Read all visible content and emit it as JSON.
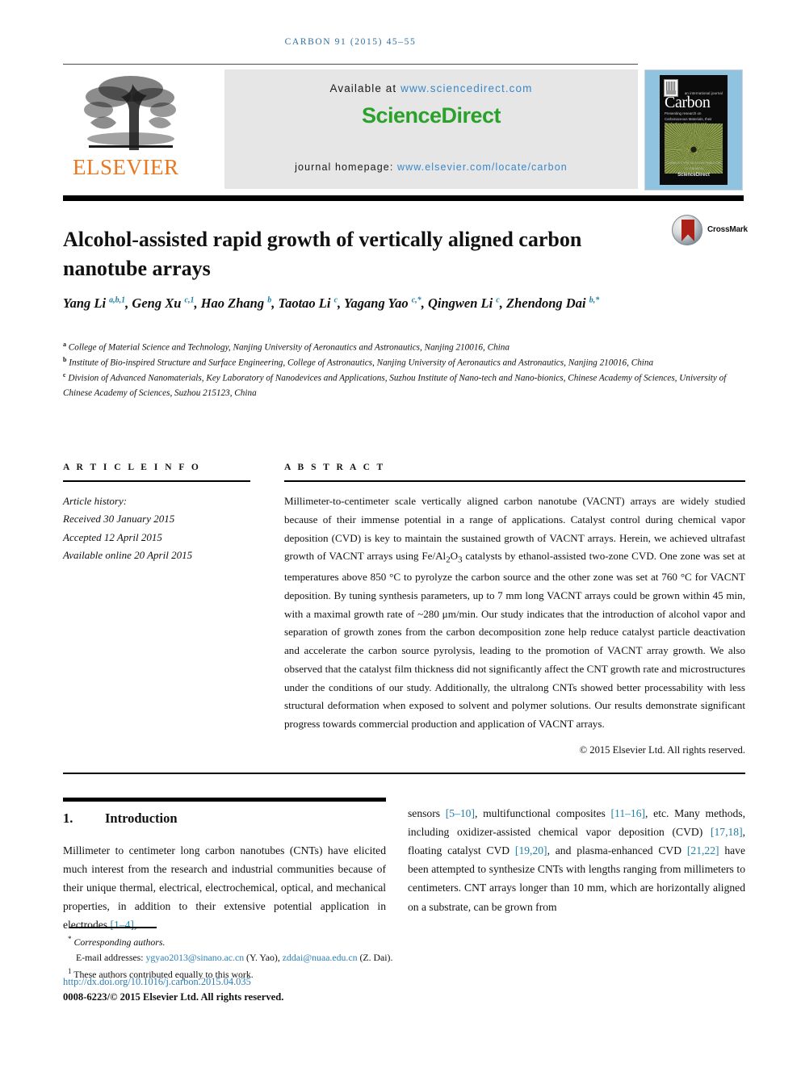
{
  "running_head": "CARBON 91 (2015) 45–55",
  "banner": {
    "publisher_name": "ELSEVIER",
    "available_prefix": "Available at ",
    "available_url": "www.sciencedirect.com",
    "sciencedirect_wordmark": "ScienceDirect",
    "homepage_prefix": "journal homepage: ",
    "homepage_url": "www.elsevier.com/locate/carbon",
    "colors": {
      "elsevier_orange": "#e87722",
      "sciencedirect_green": "#2aa12a",
      "link_blue": "#3a87c8",
      "banner_gray": "#e6e6e6"
    }
  },
  "cover": {
    "title": "Carbon",
    "kicker": "an international journal",
    "subtitle": "Presenting research on Carbonaceous Materials, their Production, Properties and Applications",
    "footer_small": "CARBON TYPE IS A CONTRIBUTOR TO CARBON",
    "footer_brand": "ScienceDirect",
    "border_color": "#8fc3e0"
  },
  "article": {
    "title": "Alcohol-assisted rapid growth of vertically aligned carbon nanotube arrays",
    "crossmark_label": "CrossMark",
    "authors_html": "Yang Li <sup>a,b,1</sup>, Geng Xu <sup>c,1</sup>, Hao Zhang <sup>b</sup>, Taotao Li <sup>c</sup>, Yagang Yao <sup>c,*</sup>, Qingwen Li <sup>c</sup>, Zhendong Dai <sup>b,*</sup>",
    "affiliations": [
      {
        "mark": "a",
        "text": "College of Material Science and Technology, Nanjing University of Aeronautics and Astronautics, Nanjing 210016, China"
      },
      {
        "mark": "b",
        "text": "Institute of Bio-inspired Structure and Surface Engineering, College of Astronautics, Nanjing University of Aeronautics and Astronautics, Nanjing 210016, China"
      },
      {
        "mark": "c",
        "text": "Division of Advanced Nanomaterials, Key Laboratory of Nanodevices and Applications, Suzhou Institute of Nano-tech and Nano-bionics, Chinese Academy of Sciences, University of Chinese Academy of Sciences, Suzhou 215123, China"
      }
    ]
  },
  "article_info": {
    "heading": "A R T I C L E   I N F O",
    "history_label": "Article history:",
    "received": "Received 30 January 2015",
    "accepted": "Accepted 12 April 2015",
    "available_online": "Available online 20 April 2015"
  },
  "abstract": {
    "heading": "A B S T R A C T",
    "text_html": "Millimeter-to-centimeter scale vertically aligned carbon nanotube (VACNT) arrays are widely studied because of their immense potential in a range of applications. Catalyst control during chemical vapor deposition (CVD) is key to maintain the sustained growth of VACNT arrays. Herein, we achieved ultrafast growth of VACNT arrays using Fe/Al<sub>2</sub>O<sub>3</sub> catalysts by ethanol-assisted two-zone CVD. One zone was set at temperatures above 850 °C to pyrolyze the carbon source and the other zone was set at 760 °C for VACNT deposition. By tuning synthesis parameters, up to 7 mm long VACNT arrays could be grown within 45 min, with a maximal growth rate of ~280 μm/min. Our study indicates that the introduction of alcohol vapor and separation of growth zones from the carbon decomposition zone help reduce catalyst particle deactivation and accelerate the carbon source pyrolysis, leading to the promotion of VACNT array growth. We also observed that the catalyst film thickness did not significantly affect the CNT growth rate and microstructures under the conditions of our study. Additionally, the ultralong CNTs showed better processability with less structural deformation when exposed to solvent and polymer solutions. Our results demonstrate significant progress towards commercial production and application of VACNT arrays.",
    "copyright": "© 2015 Elsevier Ltd. All rights reserved."
  },
  "body": {
    "section_number": "1.",
    "section_title": "Introduction",
    "left_paragraph_html": "Millimeter to centimeter long carbon nanotubes (CNTs) have elicited much interest from the research and industrial communities because of their unique thermal, electrical, electrochemical, optical, and mechanical properties, in addition to their extensive potential application in electrodes <span class=\"ref\">[1–4]</span>,",
    "right_paragraph_html": "sensors <span class=\"ref\">[5–10]</span>, multifunctional composites <span class=\"ref\">[11–16]</span>, etc. Many methods, including oxidizer-assisted chemical vapor deposition (CVD) <span class=\"ref\">[17,18]</span>, floating catalyst CVD <span class=\"ref\">[19,20]</span>, and plasma-enhanced CVD <span class=\"ref\">[21,22]</span> have been attempted to synthesize CNTs with lengths ranging from millimeters to centimeters. CNT arrays longer than 10 mm, which are horizontally aligned on a substrate, can be grown from"
  },
  "footer": {
    "corresponding_note": "Corresponding authors.",
    "email_label": "E-mail addresses:",
    "email_1": "ygyao2013@sinano.ac.cn",
    "email_1_owner": "(Y. Yao),",
    "email_2": "zddai@nuaa.edu.cn",
    "email_2_owner": "(Z. Dai).",
    "equal_contribution": "These authors contributed equally to this work.",
    "doi_url": "http://dx.doi.org/10.1016/j.carbon.2015.04.035",
    "issn_line": "0008-6223/© 2015 Elsevier Ltd. All rights reserved."
  }
}
